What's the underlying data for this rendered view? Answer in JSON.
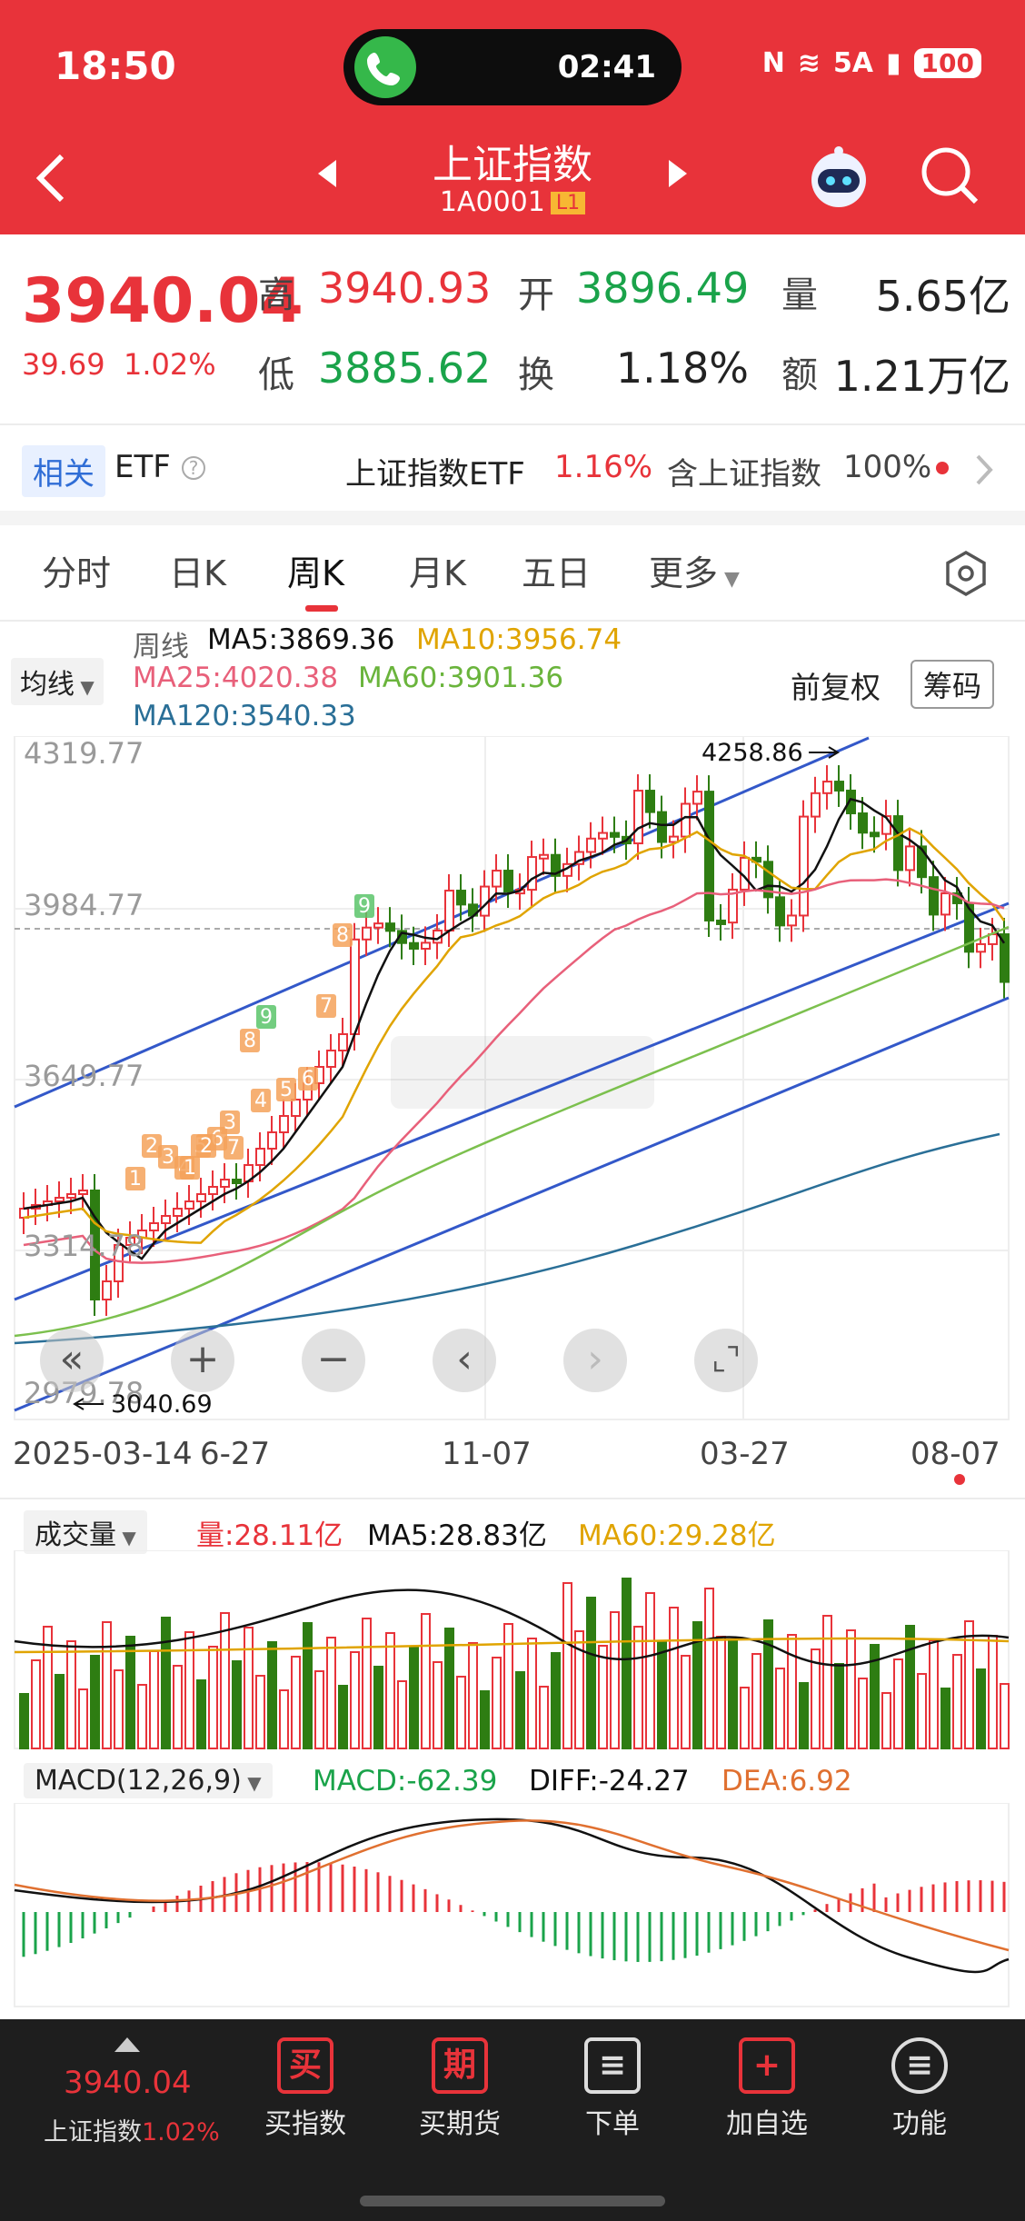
{
  "status": {
    "time": "18:50",
    "call_timer": "02:41",
    "network": "5A",
    "battery": "100"
  },
  "header": {
    "title": "上证指数",
    "code": "1A0001",
    "level": "L1"
  },
  "quote": {
    "price": "3940.04",
    "change": "39.69",
    "change_pct": "1.02%",
    "high_label": "高",
    "high": "3940.93",
    "open_label": "开",
    "open": "3896.49",
    "volume_label": "量",
    "volume": "5.65亿",
    "low_label": "低",
    "low": "3885.62",
    "turnover_label": "换",
    "turnover": "1.18%",
    "amount_label": "额",
    "amount": "1.21万亿"
  },
  "related": {
    "tag": "相关",
    "etf_label": "ETF",
    "etf_name": "上证指数ETF",
    "etf_change": "1.16%",
    "contains_label": "含上证指数",
    "contains_pct": "100%"
  },
  "tabs": [
    "分时",
    "日K",
    "周K",
    "月K",
    "五日",
    "更多"
  ],
  "active_tab": 2,
  "ma": {
    "selector": "均线",
    "period_label": "周线",
    "ma5": "MA5:3869.36",
    "ma10": "MA10:3956.74",
    "ma25": "MA25:4020.38",
    "ma60": "MA60:3901.36",
    "ma120": "MA120:3540.33",
    "adjust": "前复权",
    "chips": "筹码"
  },
  "kline": {
    "y_labels": [
      "4319.77",
      "3984.77",
      "3649.77",
      "3314.78",
      "2979.78"
    ],
    "high_marker": "4258.86",
    "low_marker": "3040.69",
    "x_labels": [
      "2025-03-14",
      "6-27",
      "11-07",
      "03-27",
      "08-07"
    ],
    "td_counts": [
      "1",
      "2",
      "3",
      "4",
      "5",
      "6",
      "7",
      "8",
      "9",
      "1",
      "2",
      "3",
      "4",
      "5",
      "6",
      "7",
      "8",
      "9"
    ]
  },
  "volume": {
    "selector": "成交量",
    "vol": "量:28.11亿",
    "ma5": "MA5:28.83亿",
    "ma60": "MA60:29.28亿"
  },
  "macd": {
    "selector": "MACD(12,26,9)",
    "macd": "MACD:-62.39",
    "diff": "DIFF:-24.27",
    "dea": "DEA:6.92"
  },
  "colors": {
    "up": "#e8333a",
    "down": "#2e7d12",
    "ma5": "#111111",
    "ma10": "#e0a400",
    "ma25": "#e8607a",
    "ma60": "#7cc04e",
    "ma120": "#2a6f97"
  },
  "nav": {
    "price": "3940.04",
    "name": "上证指数",
    "change_pct": "1.02%",
    "items": [
      {
        "icon": "买",
        "label": "买指数"
      },
      {
        "icon": "期",
        "label": "买期货"
      },
      {
        "icon": "≡",
        "label": "下单"
      },
      {
        "icon": "+",
        "label": "加自选"
      },
      {
        "icon": "≡",
        "label": "功能"
      }
    ]
  }
}
